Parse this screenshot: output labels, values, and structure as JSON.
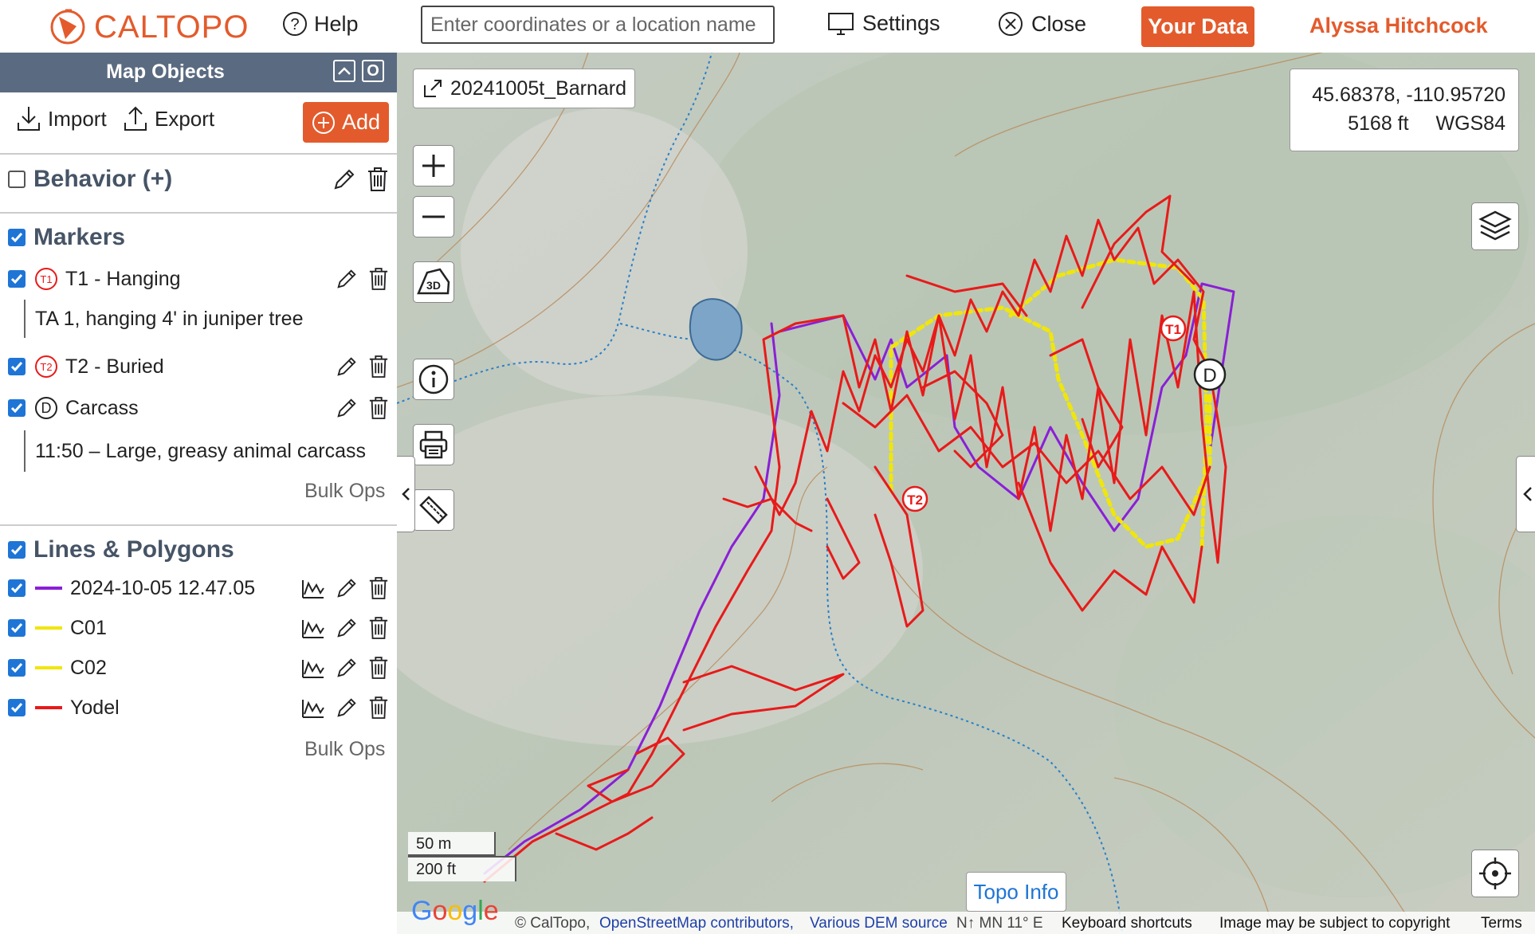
{
  "topbar": {
    "logo_text": "CALTOPO",
    "help_label": "Help",
    "search_placeholder": "Enter coordinates or a location name",
    "settings_label": "Settings",
    "close_label": "Close",
    "your_data_label": "Your Data",
    "user_name": "Alyssa Hitchcock"
  },
  "sidebar": {
    "title": "Map Objects",
    "header_btn_collapse": "^",
    "header_btn_close": "O",
    "import_label": "Import",
    "export_label": "Export",
    "add_label": "Add",
    "behavior_folder": "Behavior (+)",
    "markers_folder": "Markers",
    "markers": [
      {
        "label": "T1 - Hanging",
        "badge": "T1",
        "description": "TA 1, hanging 4' in juniper tree"
      },
      {
        "label": "T2 - Buried",
        "badge": "T2",
        "description": ""
      },
      {
        "label": "Carcass",
        "badge": "D",
        "description": "11:50 – Large, greasy animal carcass"
      }
    ],
    "bulk_ops_label": "Bulk Ops",
    "lines_folder": "Lines & Polygons",
    "lines": [
      {
        "label": "2024-10-05 12.47.05",
        "color": "#8a1fd6"
      },
      {
        "label": "C01",
        "color": "#f0e60a"
      },
      {
        "label": "C02",
        "color": "#f0e60a"
      },
      {
        "label": "Yodel",
        "color": "#e81a1a"
      }
    ]
  },
  "map": {
    "map_name": "20241005t_Barnard",
    "coords_latlon": "45.68378, -110.95720",
    "elevation": "5168 ft",
    "datum": "WGS84",
    "topo_info_label": "Topo Info",
    "scale_top": "50 m",
    "scale_bottom": "200 ft",
    "google_label": "Google",
    "attribution_caltopo": "© CalTopo,",
    "attribution_osm": "OpenStreetMap contributors,",
    "attribution_dem": "Various DEM source",
    "north_info": "N↑ MN 11° E",
    "keyboard_shortcuts": "Keyboard shortcuts",
    "copyright_note": "Image may be subject to copyright",
    "terms": "Terms",
    "marker_t1": "T1",
    "marker_t2": "T2",
    "marker_d": "D",
    "zoom_in": "+",
    "zoom_out": "−",
    "btn_3d": "3D"
  },
  "colors": {
    "accent": "#e35b2c",
    "header_bg": "#5a6a80",
    "check_blue": "#1e75d6",
    "track_purple": "#8a1fd6",
    "track_yellow": "#f0e60a",
    "track_red": "#e81a1a"
  }
}
